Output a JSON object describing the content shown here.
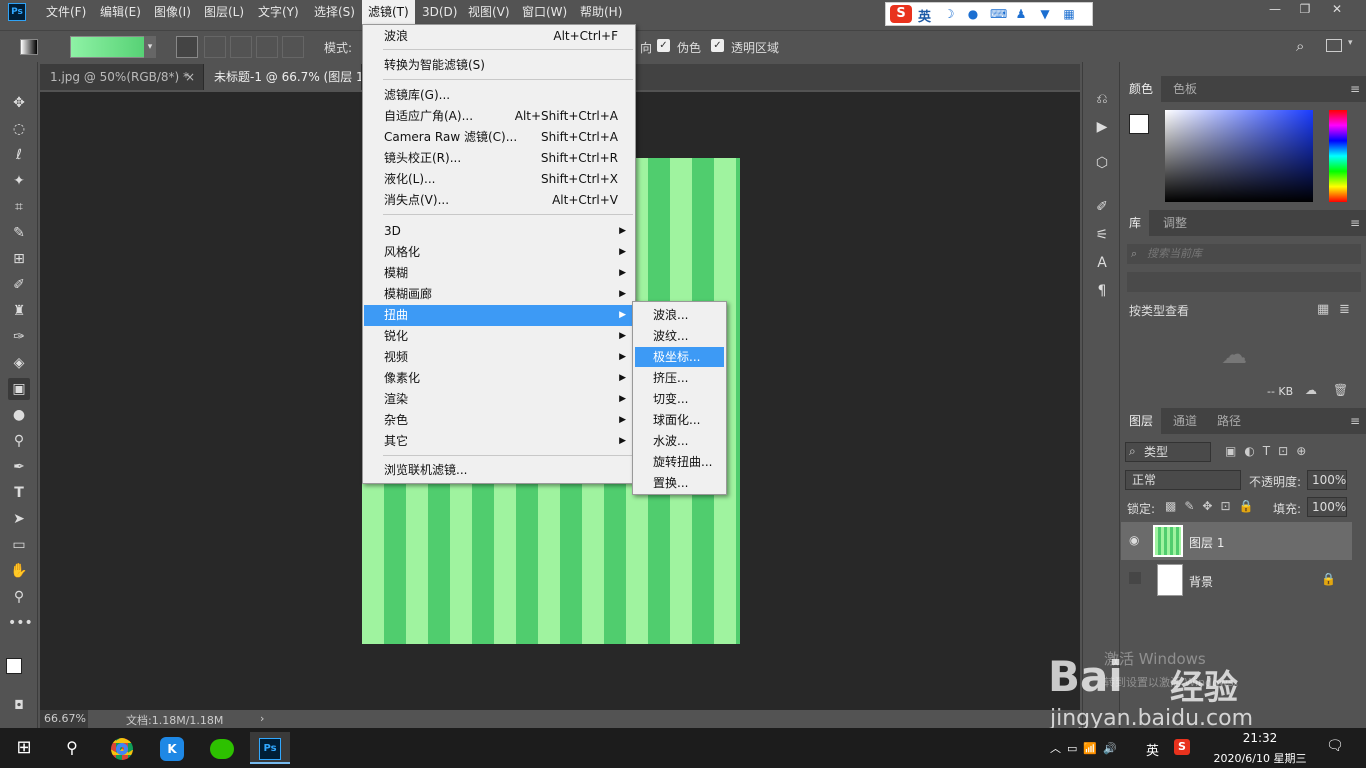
{
  "app": {
    "logo": "Ps"
  },
  "menubar": {
    "items": [
      "文件(F)",
      "编辑(E)",
      "图像(I)",
      "图层(L)",
      "文字(Y)",
      "选择(S)",
      "滤镜(T)",
      "3D(D)",
      "视图(V)",
      "窗口(W)",
      "帮助(H)"
    ],
    "open_index": 6
  },
  "ime": {
    "brand": "S",
    "mode": "英",
    "icons": [
      "moon-icon",
      "microphone-icon",
      "keyboard-icon",
      "person-icon",
      "shirt-icon",
      "grid-icon"
    ]
  },
  "options": {
    "mode_label": "模式:",
    "checkbox_dither": "伪色",
    "checkbox_transparency": "透明区域",
    "partial_label": "向"
  },
  "tabs": [
    {
      "label": "1.jpg @ 50%(RGB/8*) *",
      "close": "×"
    },
    {
      "label": "未标题-1 @ 66.7% (图层 1,",
      "close": ""
    }
  ],
  "status": {
    "zoom": "66.67%",
    "doc": "文档:1.18M/1.18M",
    "arrow": "›"
  },
  "filter_menu": {
    "items": [
      {
        "label": "波浪",
        "shortcut": "Alt+Ctrl+F"
      },
      {
        "label": "转换为智能滤镜(S)",
        "shortcut": ""
      },
      {
        "label": "滤镜库(G)...",
        "shortcut": ""
      },
      {
        "label": "自适应广角(A)...",
        "shortcut": "Alt+Shift+Ctrl+A"
      },
      {
        "label": "Camera Raw 滤镜(C)...",
        "shortcut": "Shift+Ctrl+A"
      },
      {
        "label": "镜头校正(R)...",
        "shortcut": "Shift+Ctrl+R"
      },
      {
        "label": "液化(L)...",
        "shortcut": "Shift+Ctrl+X"
      },
      {
        "label": "消失点(V)...",
        "shortcut": "Alt+Ctrl+V"
      },
      {
        "label": "3D",
        "shortcut": "▶"
      },
      {
        "label": "风格化",
        "shortcut": "▶"
      },
      {
        "label": "模糊",
        "shortcut": "▶"
      },
      {
        "label": "模糊画廊",
        "shortcut": "▶"
      },
      {
        "label": "扭曲",
        "shortcut": "▶"
      },
      {
        "label": "锐化",
        "shortcut": "▶"
      },
      {
        "label": "视频",
        "shortcut": "▶"
      },
      {
        "label": "像素化",
        "shortcut": "▶"
      },
      {
        "label": "渲染",
        "shortcut": "▶"
      },
      {
        "label": "杂色",
        "shortcut": "▶"
      },
      {
        "label": "其它",
        "shortcut": "▶"
      },
      {
        "label": "浏览联机滤镜...",
        "shortcut": ""
      }
    ],
    "highlighted": "扭曲"
  },
  "distort_submenu": {
    "items": [
      "波浪...",
      "波纹...",
      "极坐标...",
      "挤压...",
      "切变...",
      "球面化...",
      "水波...",
      "旋转扭曲...",
      "置换..."
    ],
    "highlighted": "极坐标..."
  },
  "color_panel": {
    "tabs": [
      "颜色",
      "色板"
    ],
    "foreground": "#ffffff",
    "background": "#d62f2f"
  },
  "library_panel": {
    "tabs": [
      "库",
      "调整"
    ],
    "search_placeholder": "搜索当前库",
    "view_label": "按类型查看",
    "size": "-- KB"
  },
  "layers_panel": {
    "tabs": [
      "图层",
      "通道",
      "路径"
    ],
    "filter": "类型",
    "blend": "正常",
    "opacity_label": "不透明度:",
    "opacity": "100%",
    "lock_label": "锁定:",
    "fill_label": "填充:",
    "fill": "100%",
    "layers": [
      {
        "name": "图层 1",
        "selected": true
      },
      {
        "name": "背景",
        "selected": false
      }
    ]
  },
  "watermark": {
    "brand": "Bai",
    "brand2": "经验",
    "url": "jingyan.baidu.com",
    "activate": "激活 Windows",
    "activate_sub": "转到设置以激活 Windows。"
  },
  "taskbar": {
    "time": "21:32",
    "date": "2020/6/10 星期三",
    "lang": "英",
    "ps": "Ps"
  }
}
